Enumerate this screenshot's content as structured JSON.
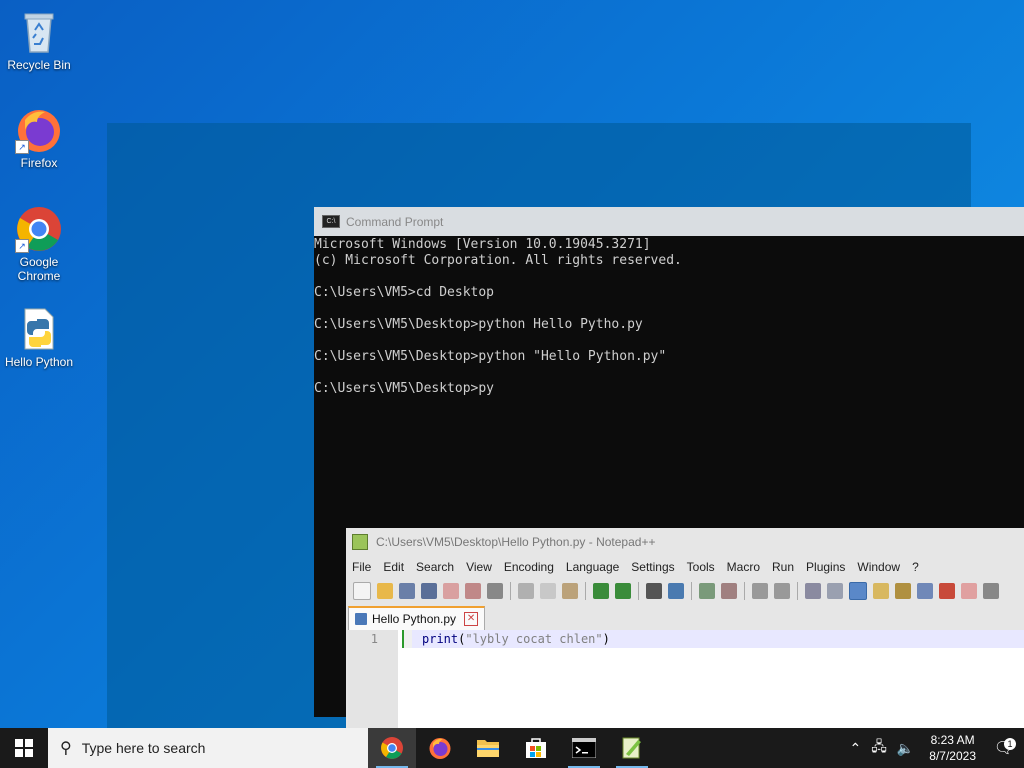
{
  "desktop_icons": [
    {
      "label": "Recycle Bin"
    },
    {
      "label": "Firefox"
    },
    {
      "label": "Google Chrome"
    },
    {
      "label": "Hello Python"
    }
  ],
  "cmd": {
    "title": "Command Prompt",
    "lines": [
      "Microsoft Windows [Version 10.0.19045.3271]",
      "(c) Microsoft Corporation. All rights reserved.",
      "",
      "C:\\Users\\VM5>cd Desktop",
      "",
      "C:\\Users\\VM5\\Desktop>python Hello Pytho.py",
      "",
      "C:\\Users\\VM5\\Desktop>python \"Hello Python.py\"",
      "",
      "C:\\Users\\VM5\\Desktop>py"
    ]
  },
  "npp": {
    "title": "C:\\Users\\VM5\\Desktop\\Hello Python.py - Notepad++",
    "menu": [
      "File",
      "Edit",
      "Search",
      "View",
      "Encoding",
      "Language",
      "Settings",
      "Tools",
      "Macro",
      "Run",
      "Plugins",
      "Window",
      "?"
    ],
    "tab": "Hello Python.py",
    "close_glyph": "✕",
    "line_number": "1",
    "code": {
      "fn": "print",
      "open": "(",
      "str": "\"lybly cocat chlen\"",
      "close": ")"
    }
  },
  "taskbar": {
    "search_placeholder": "Type here to search",
    "time": "8:23 AM",
    "date": "8/7/2023",
    "notification_count": "1"
  }
}
